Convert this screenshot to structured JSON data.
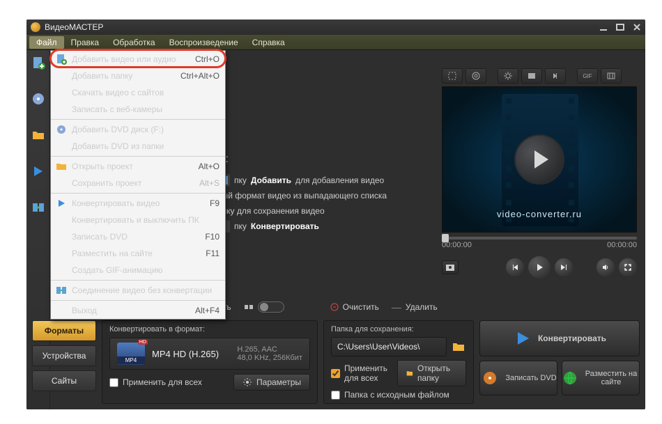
{
  "title": "ВидеоМАСТЕР",
  "menubar": [
    "Файл",
    "Правка",
    "Обработка",
    "Воспроизведение",
    "Справка"
  ],
  "dropdown": {
    "items": [
      {
        "label": "Добавить видео или аудио",
        "shortcut": "Ctrl+O",
        "highlight": true
      },
      {
        "label": "Добавить папку",
        "shortcut": "Ctrl+Alt+O"
      },
      {
        "label": "Скачать видео с сайтов",
        "shortcut": ""
      },
      {
        "label": "Записать с веб-камеры",
        "shortcut": ""
      },
      {
        "sep": true
      },
      {
        "label": "Добавить DVD диск (F:)",
        "shortcut": ""
      },
      {
        "label": "Добавить DVD из папки",
        "shortcut": ""
      },
      {
        "sep": true
      },
      {
        "label": "Открыть проект",
        "shortcut": "Alt+O"
      },
      {
        "label": "Сохранить проект",
        "shortcut": "Alt+S",
        "disabled": true
      },
      {
        "sep": true
      },
      {
        "label": "Конвертировать видео",
        "shortcut": "F9"
      },
      {
        "label": "Конвертировать и выключить ПК",
        "shortcut": ""
      },
      {
        "label": "Записать DVD",
        "shortcut": "F10"
      },
      {
        "label": "Разместить на сайте",
        "shortcut": "F11"
      },
      {
        "label": "Создать GIF-анимацию",
        "shortcut": "",
        "disabled": true
      },
      {
        "sep": true
      },
      {
        "label": "Соединение видео без конвертации",
        "shortcut": ""
      },
      {
        "sep": true
      },
      {
        "label": "Выход",
        "shortcut": "Alt+F4"
      }
    ]
  },
  "instructions": {
    "head": "ы:",
    "l1a": "пку",
    "l1b": "Добавить",
    "l1c": " для добавления видео",
    "l2": "ный формат видео из выпадающего списка",
    "l3": "апку для сохранения видео",
    "l4a": "пку ",
    "l4b": "Конвертировать"
  },
  "preview": {
    "brand": "video-converter.ru",
    "cur": "00:00:00",
    "dur": "00:00:00"
  },
  "mid": {
    "cut": "зать",
    "clear": "Очистить",
    "del": "Удалить"
  },
  "tabs": {
    "formats": "Форматы",
    "devices": "Устройства",
    "sites": "Сайты"
  },
  "format": {
    "header": "Конвертировать в формат:",
    "name": "MP4 HD (H.265)",
    "codec": "H.265, AAC",
    "bitrate": "48,0 KHz, 256Кбит",
    "applyAll": "Применить для всех",
    "params": "Параметры"
  },
  "folder": {
    "header": "Папка для сохранения:",
    "path": "C:\\Users\\User\\Videos\\",
    "applyAll": "Применить для всех",
    "sourceFolder": "Папка с исходным файлом",
    "open": "Открыть папку"
  },
  "actions": {
    "convert": "Конвертировать",
    "burn": "Записать DVD",
    "publish": "Разместить на сайте"
  }
}
